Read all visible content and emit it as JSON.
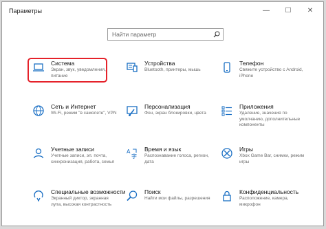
{
  "window": {
    "title": "Параметры",
    "minimize_glyph": "—",
    "maximize_glyph": "☐",
    "close_glyph": "✕"
  },
  "search": {
    "placeholder": "Найти параметр",
    "icon": "search-icon"
  },
  "highlight_color": "#e5222a",
  "tiles": [
    {
      "title": "Система",
      "desc": "Экран, звук, уведомления, питание",
      "icon": "laptop-icon"
    },
    {
      "title": "Устройства",
      "desc": "Bluetooth, принтеры, мышь",
      "icon": "devices-icon"
    },
    {
      "title": "Телефон",
      "desc": "Свяжите устройство с Android, iPhone",
      "icon": "phone-icon"
    },
    {
      "title": "Сеть и Интернет",
      "desc": "Wi-Fi, режим \"в самолете\", VPN",
      "icon": "globe-icon"
    },
    {
      "title": "Персонализация",
      "desc": "Фон, экран блокировки, цвета",
      "icon": "brush-icon"
    },
    {
      "title": "Приложения",
      "desc": "Удаление, значения по умолчанию, дополнительные компоненты",
      "icon": "apps-list-icon"
    },
    {
      "title": "Учетные записи",
      "desc": "Учетные записи, эл. почта, синхронизация, работа, семья",
      "icon": "account-icon"
    },
    {
      "title": "Время и язык",
      "desc": "Распознавание голоса, регион, дата",
      "icon": "time-language-icon"
    },
    {
      "title": "Игры",
      "desc": "Xbox Game Bar, снимки, режим игры",
      "icon": "xbox-icon"
    },
    {
      "title": "Специальные возможности",
      "desc": "Экранный диктор, экранная лупа, высокая контрастность",
      "icon": "accessibility-icon"
    },
    {
      "title": "Поиск",
      "desc": "Найти мои файлы, разрешения",
      "icon": "search-category-icon"
    },
    {
      "title": "Конфиденциальность",
      "desc": "Расположение, камера, микрофон",
      "icon": "lock-icon"
    }
  ]
}
